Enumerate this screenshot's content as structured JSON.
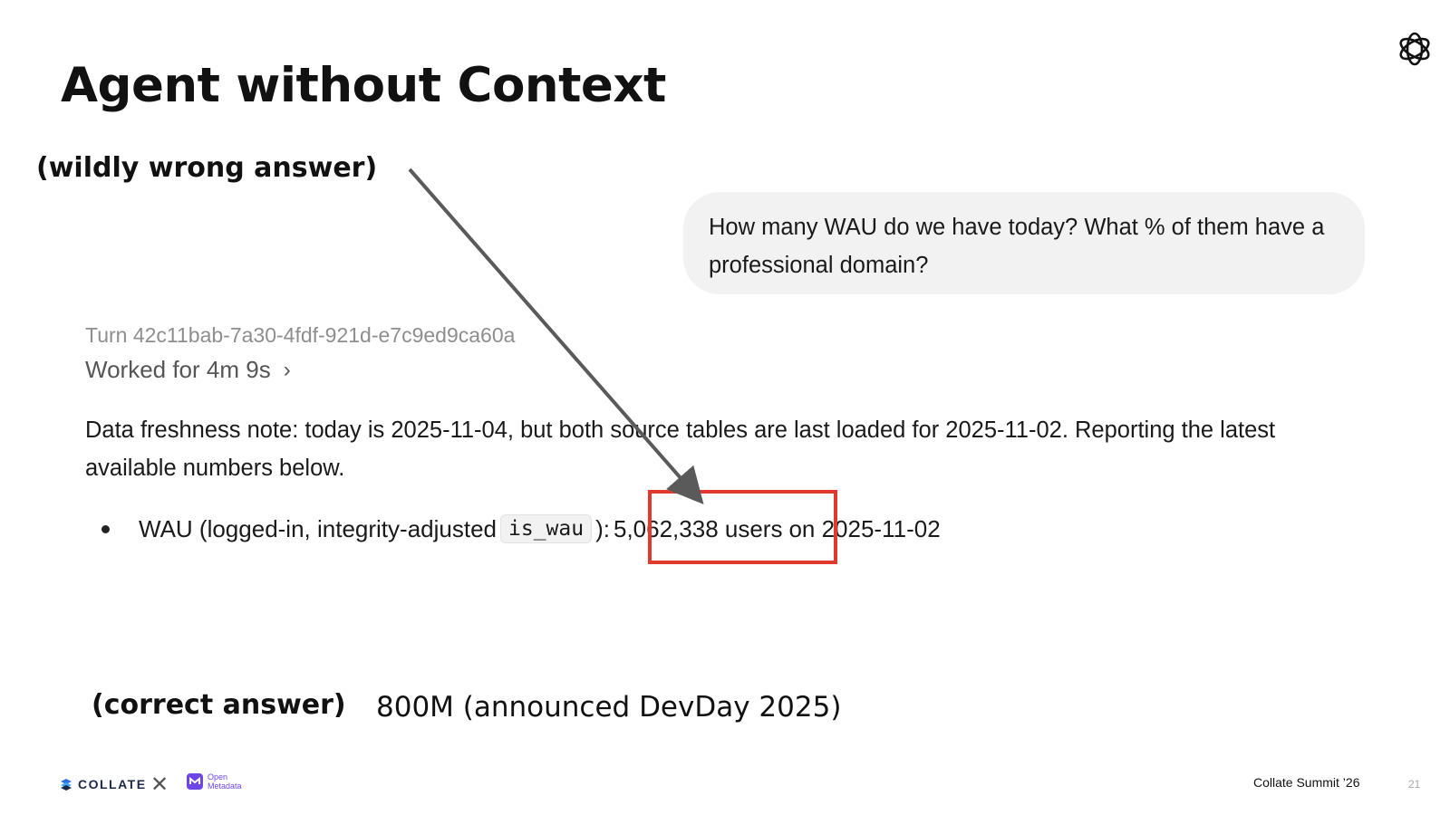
{
  "slide": {
    "title": "Agent without Context",
    "note_wrong": "(wildly wrong answer)",
    "note_correct": "(correct answer)",
    "correct_value": "800M (announced DevDay 2025)"
  },
  "chat": {
    "user_message": "How many WAU do we have today? What % of them have a professional domain?",
    "turn_id": "Turn 42c11bab-7a30-4fdf-921d-e7c9ed9ca60a",
    "worked_label": "Worked for 4m 9s",
    "freshness_note": "Data freshness note: today is 2025-11-04, but both source tables are last loaded for 2025-11-02. Reporting the latest available numbers below.",
    "bullet": {
      "prefix": "WAU (logged-in, integrity-adjusted",
      "code": "is_wau",
      "after_code": "):",
      "value": "5,062,338 users",
      "suffix": "on 2025-11-02"
    }
  },
  "footer": {
    "brand_left": "COLLATE",
    "brand_partner_line1": "Open",
    "brand_partner_line2": "Metadata",
    "event": "Collate Summit ’26",
    "page_number": "21"
  },
  "colors": {
    "highlight": "#e03a2e",
    "bubble": "#f2f2f2",
    "arrow": "#5a5a5a",
    "openmetadata": "#6e46e8"
  },
  "icons": [
    "openai-logo-icon",
    "chevron-right-icon",
    "collate-logo-icon",
    "openmetadata-logo-icon",
    "close-x-icon"
  ]
}
